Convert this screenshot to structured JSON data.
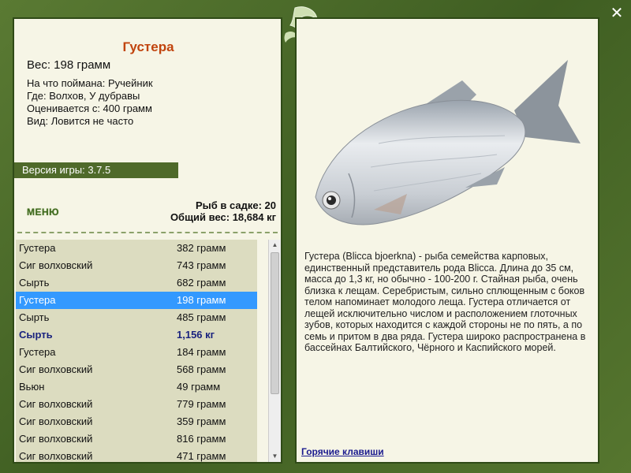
{
  "fish": {
    "name": "Густера",
    "weight": "Вес: 198 грамм",
    "caught_on": "На что поймана: Ручейник",
    "location": "Где: Волхов, У дубравы",
    "price": "Оценивается с: 400 грамм",
    "rarity": "Вид: Ловится не часто"
  },
  "version": "Версия игры: 3.7.5",
  "menu_label": "МЕНЮ",
  "stats": {
    "count": "Рыб в садке: 20",
    "total": "Общий вес: 18,684 кг"
  },
  "catch_list": [
    {
      "name": "Густера",
      "weight": "382 грамм",
      "selected": false,
      "highlight": false
    },
    {
      "name": "Сиг волховский",
      "weight": "743 грамм",
      "selected": false,
      "highlight": false
    },
    {
      "name": "Сырть",
      "weight": "682 грамм",
      "selected": false,
      "highlight": false
    },
    {
      "name": "Густера",
      "weight": "198 грамм",
      "selected": true,
      "highlight": false
    },
    {
      "name": "Сырть",
      "weight": "485 грамм",
      "selected": false,
      "highlight": false
    },
    {
      "name": "Сырть",
      "weight": "1,156 кг",
      "selected": false,
      "highlight": true
    },
    {
      "name": "Густера",
      "weight": "184 грамм",
      "selected": false,
      "highlight": false
    },
    {
      "name": "Сиг волховский",
      "weight": "568 грамм",
      "selected": false,
      "highlight": false
    },
    {
      "name": "Вьюн",
      "weight": "49 грамм",
      "selected": false,
      "highlight": false
    },
    {
      "name": "Сиг волховский",
      "weight": "779 грамм",
      "selected": false,
      "highlight": false
    },
    {
      "name": "Сиг волховский",
      "weight": "359 грамм",
      "selected": false,
      "highlight": false
    },
    {
      "name": "Сиг волховский",
      "weight": "816 грамм",
      "selected": false,
      "highlight": false
    },
    {
      "name": "Сиг волховский",
      "weight": "471 грамм",
      "selected": false,
      "highlight": false
    }
  ],
  "description": "Густера (Blicca bjoerkna) - рыба семейства карповых, единственный представитель рода Blicca. Длина до 35 см, масса до 1,3 кг, но обычно - 100-200 г. Стайная рыба, очень близка к лещам. Серебристым, сильно сплющенным с боков телом напоминает молодого леща. Густера отличается от лещей исключительно числом и расположением глоточных зубов, которых находится с каждой стороны не по пять, а по семь и притом в два ряда. Густера широко распространена в бассейнах Балтийского, Чёрного и Каспийского морей.",
  "hotkeys_label": "Горячие клавиши",
  "colors": {
    "frame": "#4d6b2b",
    "panel": "#f6f5e6",
    "title": "#c1440e",
    "selected_row": "#3399ff",
    "highlight_row": "#1a237e"
  },
  "icons": {
    "close": "close-icon",
    "fish": "fish-image",
    "decoration": "fish-emblem-icon"
  }
}
